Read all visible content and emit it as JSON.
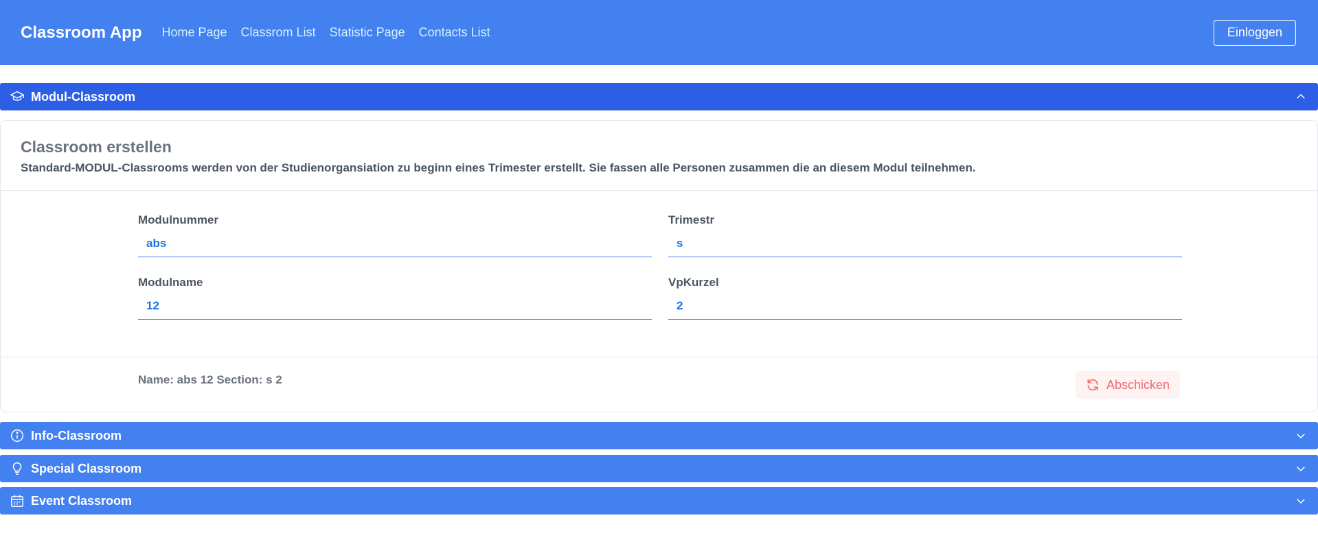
{
  "navbar": {
    "brand": "Classroom App",
    "links": [
      "Home Page",
      "Classrom List",
      "Statistic Page",
      "Contacts List"
    ],
    "login_label": "Einloggen"
  },
  "accordion": {
    "modul": {
      "title": "Modul-Classroom",
      "icon": "graduation-cap-icon",
      "expanded": true
    },
    "info": {
      "title": "Info-Classroom",
      "icon": "info-circle-icon",
      "expanded": false
    },
    "special": {
      "title": "Special Classroom",
      "icon": "lightbulb-icon",
      "expanded": false
    },
    "event": {
      "title": "Event Classroom",
      "icon": "calendar-icon",
      "expanded": false
    }
  },
  "form": {
    "title": "Classroom erstellen",
    "subtitle": "Standard-MODUL-Classrooms werden von der Studienorgansiation zu beginn eines Trimester erstellt. Sie fassen alle Personen zusammen die an diesem Modul teilnehmen.",
    "fields": {
      "modulnummer": {
        "label": "Modulnummer",
        "value": "abs"
      },
      "trimestr": {
        "label": "Trimestr",
        "value": "s"
      },
      "modulname": {
        "label": "Modulname",
        "value": "12"
      },
      "vpkurzel": {
        "label": "VpKurzel",
        "value": "2"
      }
    },
    "summary": "Name: abs 12 Section: s 2",
    "submit_label": "Abschicken"
  },
  "colors": {
    "navbar": "#4381f0",
    "accordion_active": "#2c5fe6",
    "accordion": "#4381f0",
    "input_text": "#1a73e8",
    "submit_text": "#ef6a6a",
    "submit_bg": "#fef2f2"
  }
}
